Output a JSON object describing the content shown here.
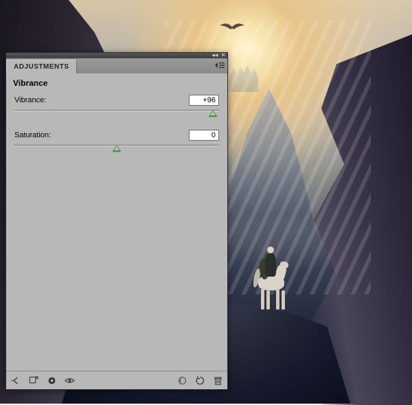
{
  "panel": {
    "tab_label": "ADJUSTMENTS",
    "title": "Vibrance",
    "menu_icon": "panel-menu-icon",
    "topbar": {
      "collapse_icon": "collapse-icon",
      "close_icon": "close-icon"
    }
  },
  "sliders": {
    "vibrance": {
      "label": "Vibrance:",
      "value": "+96",
      "position_pct": 97
    },
    "saturation": {
      "label": "Saturation:",
      "value": "0",
      "position_pct": 50
    }
  },
  "footer_left": {
    "back": "back-arrow-icon",
    "expand": "expand-view-icon",
    "clip": "clip-to-layer-icon",
    "visibility": "eye-icon"
  },
  "footer_right": {
    "previous": "view-previous-icon",
    "reset": "reset-icon",
    "trash": "trash-icon"
  },
  "scene": {
    "bird": "bird-icon"
  }
}
